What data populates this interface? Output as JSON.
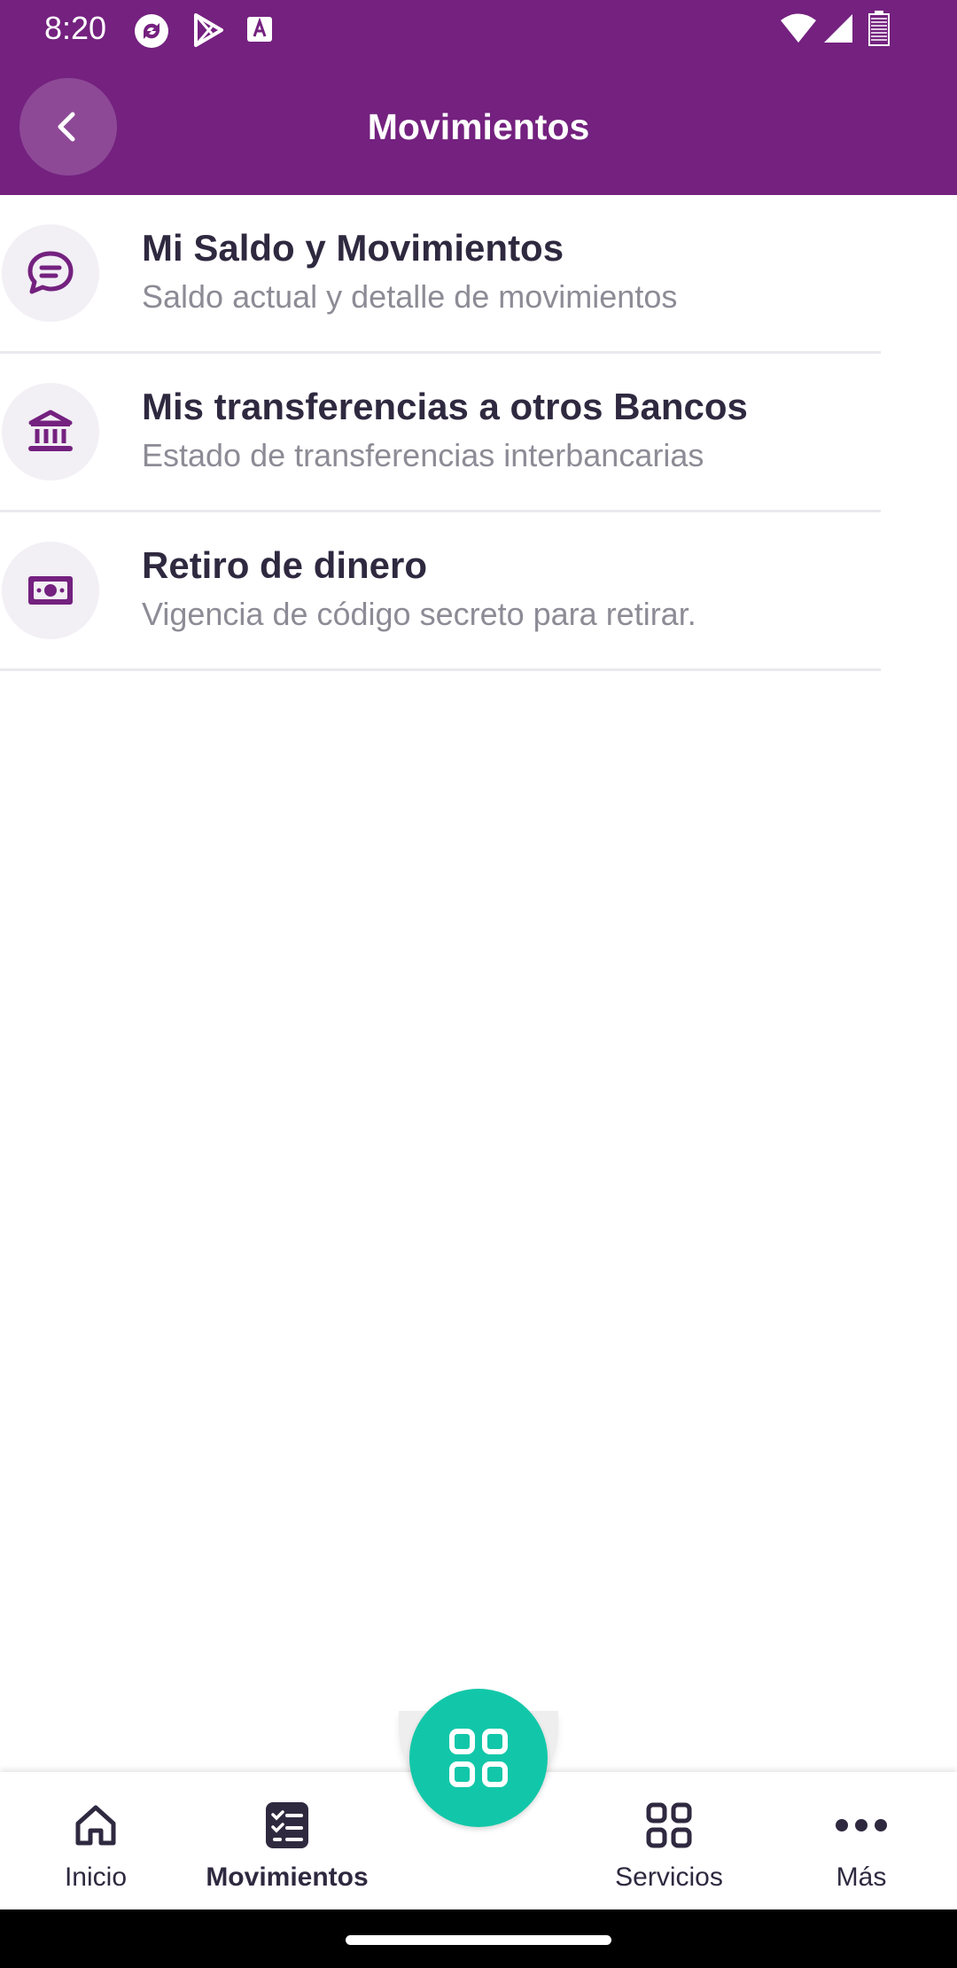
{
  "status_bar": {
    "time": "8:20",
    "icons": [
      "sync-app-icon",
      "play-store-icon",
      "font-app-icon",
      "wifi-icon",
      "signal-icon",
      "battery-icon"
    ]
  },
  "header": {
    "title": "Movimientos",
    "back_icon": "chevron-left-icon"
  },
  "items": [
    {
      "title": "Mi Saldo y Movimientos",
      "subtitle": "Saldo actual y detalle de movimientos",
      "icon": "chat-bubble-icon"
    },
    {
      "title": "Mis transferencias a otros Bancos",
      "subtitle": "Estado de transferencias interbancarias",
      "icon": "bank-icon"
    },
    {
      "title": "Retiro de dinero",
      "subtitle": "Vigencia de código secreto para retirar.",
      "icon": "cash-icon"
    }
  ],
  "nav": {
    "items": [
      {
        "label": "Inicio",
        "icon": "home-icon"
      },
      {
        "label": "Movimientos",
        "icon": "checklist-icon",
        "active": true
      },
      {
        "label": "Servicios",
        "icon": "grid-icon"
      },
      {
        "label": "Más",
        "icon": "more-dots-icon"
      }
    ],
    "fab_icon": "grid-icon"
  },
  "colors": {
    "brand_purple": "#74217f",
    "icon_purple": "#74217f",
    "fab_teal": "#12c7a9",
    "text_dark": "#2f2940",
    "text_muted": "#8d8b95"
  }
}
